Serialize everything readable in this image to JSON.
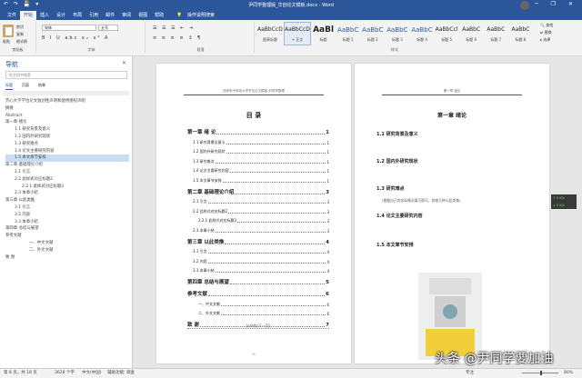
{
  "titlebar": {
    "title": "尹同学整理版_华创论文模板.docx - Word",
    "qa": "↶ ↷ 💾 ▾",
    "win": "─ ❐ ✕"
  },
  "tabs": [
    "文件",
    "开始",
    "插入",
    "设计",
    "布局",
    "引用",
    "邮件",
    "审阅",
    "视图",
    "帮助"
  ],
  "tell": "操作说明搜索",
  "ribbon": {
    "paste": "粘贴",
    "cut": "剪切",
    "copy": "复制",
    "painter": "格式刷",
    "clipboard": "剪贴板",
    "font": "宋体",
    "size": "五号",
    "font_group": "字体",
    "para_group": "段落",
    "styles_group": "样式",
    "fmt_row": "B I U abc x₂ x² A",
    "para_row": "≡ ≡ ≡ ≡ ↕ ¶",
    "styles": [
      {
        "preview": "AaBbCcDi",
        "name": "图表标题"
      },
      {
        "preview": "AaBbCcDi",
        "name": "+ 正文"
      },
      {
        "preview": "AaBl",
        "name": "标题"
      },
      {
        "preview": "AaBbC",
        "name": "标题 1"
      },
      {
        "preview": "AaBbC",
        "name": "标题 2"
      },
      {
        "preview": "AaBbC",
        "name": "标题 3"
      },
      {
        "preview": "AaBbC",
        "name": "标题 4"
      },
      {
        "preview": "AaBbCcl",
        "name": "标题 5"
      },
      {
        "preview": "AaBbC",
        "name": "标题 6"
      },
      {
        "preview": "AaBbC",
        "name": "标题 7"
      },
      {
        "preview": "AaBbC",
        "name": "标题 8"
      }
    ],
    "edit": [
      "查找",
      "替换",
      "选择"
    ],
    "edit_group": "编辑"
  },
  "nav": {
    "title": "导航",
    "close": "✕",
    "search_placeholder": "在文档中搜索",
    "tabs": [
      "标题",
      "页面",
      "结果"
    ],
    "items": [
      {
        "t": "芥心大学学位论文独创性声明和使用授权声明",
        "l": 1
      },
      {
        "t": "摘要",
        "l": 1
      },
      {
        "t": "Abstract",
        "l": 1
      },
      {
        "t": "第一章 绪论",
        "l": 1
      },
      {
        "t": "1.1 研究背景及意义",
        "l": 2
      },
      {
        "t": "1.2 国内外研究现状",
        "l": 2
      },
      {
        "t": "1.3 研究难点",
        "l": 2
      },
      {
        "t": "1.4 论文主要研究内容",
        "l": 2
      },
      {
        "t": "1.5 本文章节安排",
        "l": 2,
        "sel": true
      },
      {
        "t": "第二章 基础理论介绍",
        "l": 1
      },
      {
        "t": "2.1 引言",
        "l": 2
      },
      {
        "t": "2.2 此样式对应标题2",
        "l": 2
      },
      {
        "t": "2.2.1 此样式对应标题3",
        "l": 3
      },
      {
        "t": "2.3 本章小结",
        "l": 2
      },
      {
        "t": "第三章 以此类推",
        "l": 1
      },
      {
        "t": "3.1 引言",
        "l": 2
      },
      {
        "t": "3.2 内容",
        "l": 2
      },
      {
        "t": "3.3 本章小结",
        "l": 2
      },
      {
        "t": "第四章 总结与展望",
        "l": 1
      },
      {
        "t": "参考文献",
        "l": 1
      },
      {
        "t": "一、中文文献",
        "l": 4
      },
      {
        "t": "二、外文文献",
        "l": 4
      },
      {
        "t": "致 谢",
        "l": 1
      }
    ]
  },
  "page1": {
    "header": "西安电子科技大学学位论文模板-尹同学整理",
    "title": "目  录",
    "toc": [
      {
        "t": "第一章  绪    论",
        "p": "1",
        "k": "ch"
      },
      {
        "t": "1.1  研究背景及意义",
        "p": "1",
        "k": "s"
      },
      {
        "t": "1.2  国内外研究现状",
        "p": "1",
        "k": "s"
      },
      {
        "t": "1.3  研究难点",
        "p": "1",
        "k": "s"
      },
      {
        "t": "1.4  论文主要研究内容",
        "p": "1",
        "k": "s"
      },
      {
        "t": "1.5  本文章节安排",
        "p": "1",
        "k": "s"
      },
      {
        "t": "第二章  基础理论介绍",
        "p": "3",
        "k": "ch"
      },
      {
        "t": "2.1  引言",
        "p": "3",
        "k": "s"
      },
      {
        "t": "2.2  此样式对应标题2",
        "p": "3",
        "k": "s"
      },
      {
        "t": "2.2.1  此样式对应标题3",
        "p": "3",
        "k": "s3"
      },
      {
        "t": "2.3  本章小结",
        "p": "3",
        "k": "s"
      },
      {
        "t": "第三章  以此类推",
        "p": "4",
        "k": "ch"
      },
      {
        "t": "3.1  引言",
        "p": "4",
        "k": "s"
      },
      {
        "t": "3.2  内容",
        "p": "4",
        "k": "s"
      },
      {
        "t": "3.3  本章小结",
        "p": "4",
        "k": "s"
      },
      {
        "t": "第四章  总结与展望",
        "p": "5",
        "k": "ch"
      },
      {
        "t": "参考文献",
        "p": "6",
        "k": "ch"
      },
      {
        "t": "一、中文文献",
        "p": "6",
        "k": "s3"
      },
      {
        "t": "二、外文文献",
        "p": "6",
        "k": "s3"
      },
      {
        "t": "致    谢",
        "p": "7",
        "k": "ch"
      }
    ],
    "section_break": "分节符(下一页)",
    "footer": "III"
  },
  "page2": {
    "header": "第一章  绪论",
    "chapter": "第一章  绪论",
    "h1": "1.1  研究背景及意义",
    "h2": "1.2  国内外研究现状",
    "h3": "1.3  研究难点",
    "body3": "(根据自己的实际情况填写即可，其他几种以此类推)",
    "h4": "1.4  论文主要研究内容",
    "h5": "1.5  本文章节安排"
  },
  "sidebox": [
    "↑ 0 K/s",
    "↓ 0 K/s"
  ],
  "status": {
    "page": "第 8 页，共 18 页",
    "words": "3628 个字",
    "lang": "中文(中国)",
    "a11y": "辅助功能: 调查",
    "focus": "专注",
    "zoom": "80%"
  },
  "watermark": "头条 @尹同学要加油"
}
